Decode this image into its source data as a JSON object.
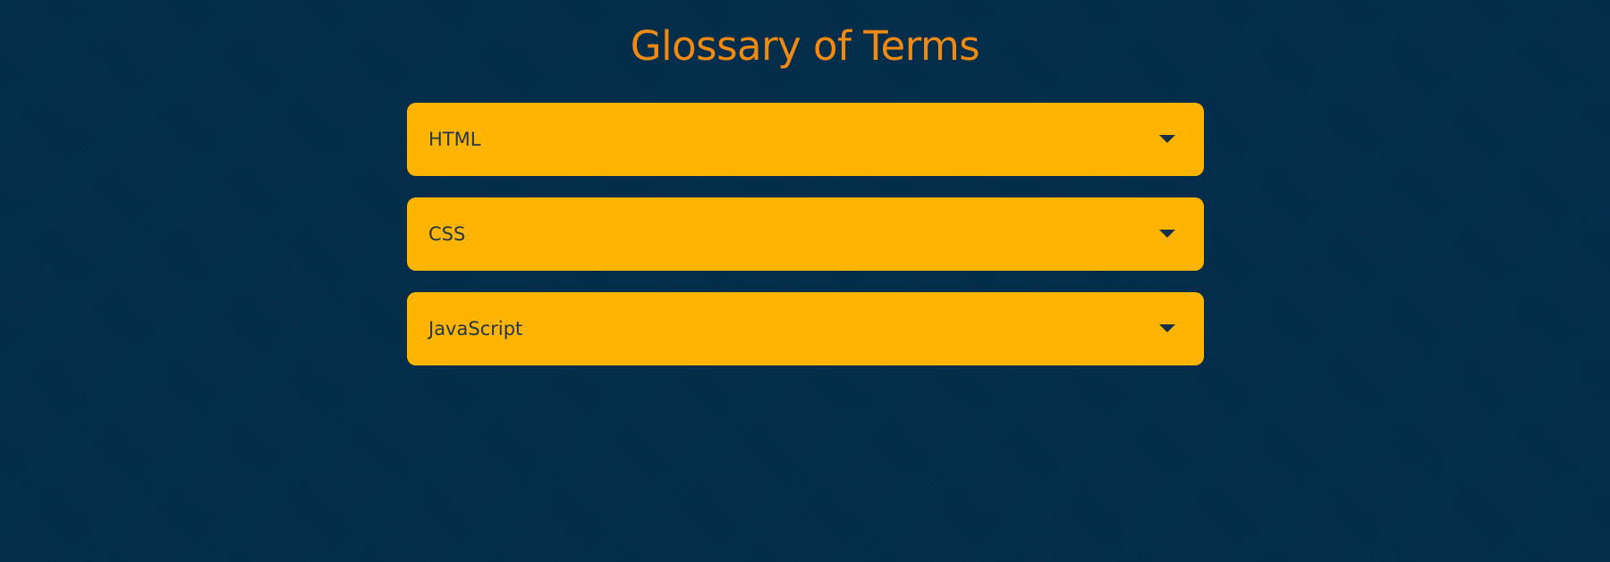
{
  "header": {
    "title": "Glossary of Terms"
  },
  "accordion": {
    "items": [
      {
        "label": "HTML",
        "icon": "chevron-down-icon"
      },
      {
        "label": "CSS",
        "icon": "chevron-down-icon"
      },
      {
        "label": "JavaScript",
        "icon": "chevron-down-icon"
      }
    ]
  },
  "colors": {
    "background": "#022d4b",
    "title": "#f28a12",
    "item_background": "#ffb400",
    "item_text": "#23364a",
    "icon": "#17314b"
  }
}
